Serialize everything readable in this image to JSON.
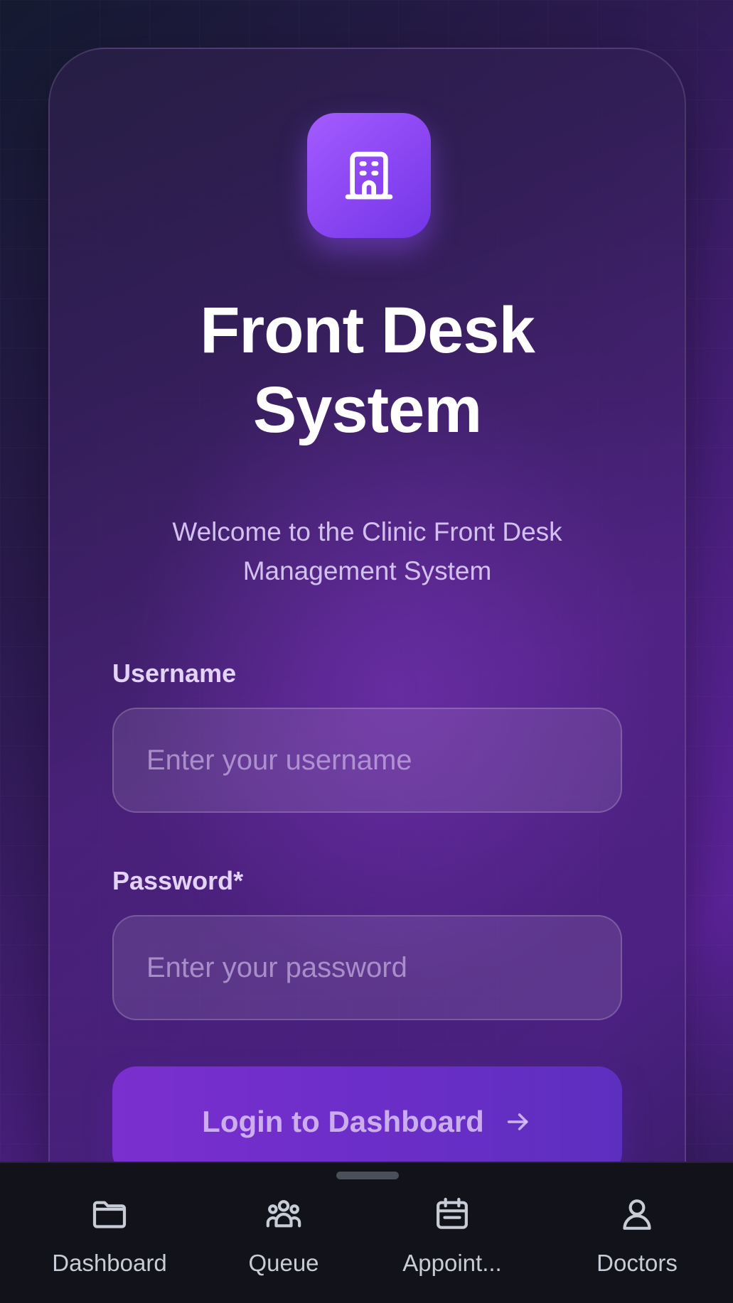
{
  "app": {
    "title_line1": "Front Desk",
    "title_line2": "System",
    "subtitle": "Welcome to the Clinic Front Desk Management System",
    "logo_icon": "building-icon"
  },
  "form": {
    "username_label": "Username",
    "username_placeholder": "Enter your username",
    "username_value": "",
    "password_label": "Password*",
    "password_placeholder": "Enter your password",
    "password_value": "",
    "submit_label": "Login to Dashboard",
    "submit_icon": "arrow-right-icon"
  },
  "bottom_nav": {
    "items": [
      {
        "label": "Dashboard",
        "icon": "folder-icon"
      },
      {
        "label": "Queue",
        "icon": "users-icon"
      },
      {
        "label": "Appoint...",
        "icon": "calendar-icon"
      },
      {
        "label": "Doctors",
        "icon": "user-icon"
      }
    ]
  },
  "colors": {
    "accent": "#8a45f2",
    "button": "#6c2ec8",
    "nav_bg": "#12131a"
  }
}
